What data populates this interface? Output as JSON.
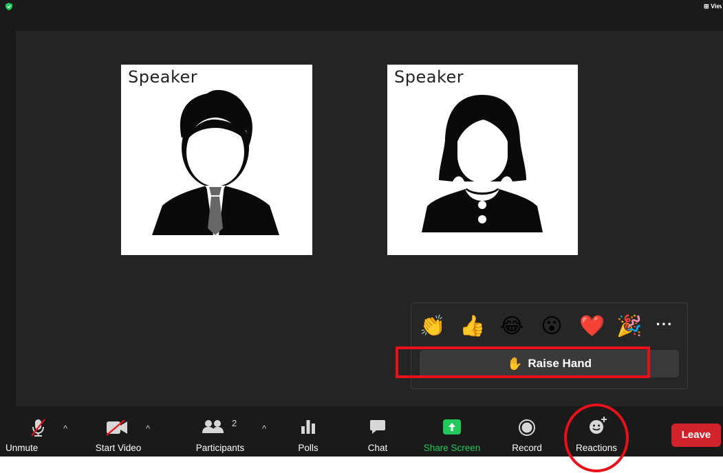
{
  "window": {
    "view_label": "View"
  },
  "participants": [
    {
      "label": "Speaker",
      "avatar": "man-avatar"
    },
    {
      "label": "Speaker",
      "avatar": "woman-avatar"
    }
  ],
  "reactions_panel": {
    "emojis": [
      {
        "name": "clapping-hands-icon",
        "glyph": "👏"
      },
      {
        "name": "thumbs-up-icon",
        "glyph": "👍"
      },
      {
        "name": "tears-of-joy-icon",
        "glyph": "😂"
      },
      {
        "name": "open-mouth-icon",
        "glyph": "😮"
      },
      {
        "name": "red-heart-icon",
        "glyph": "❤️"
      },
      {
        "name": "party-popper-icon",
        "glyph": "🎉"
      }
    ],
    "more_label": "···",
    "raise_hand": {
      "icon": "✋",
      "label": "Raise Hand"
    }
  },
  "toolbar": {
    "unmute": "Unmute",
    "start_video": "Start Video",
    "participants": "Participants",
    "participants_count": "2",
    "polls": "Polls",
    "chat": "Chat",
    "share_screen": "Share Screen",
    "record": "Record",
    "reactions": "Reactions",
    "leave": "Leave",
    "caret": "^"
  },
  "colors": {
    "share_green": "#22c95a",
    "leave_red": "#d0232c",
    "highlight_red": "#e8101a"
  }
}
